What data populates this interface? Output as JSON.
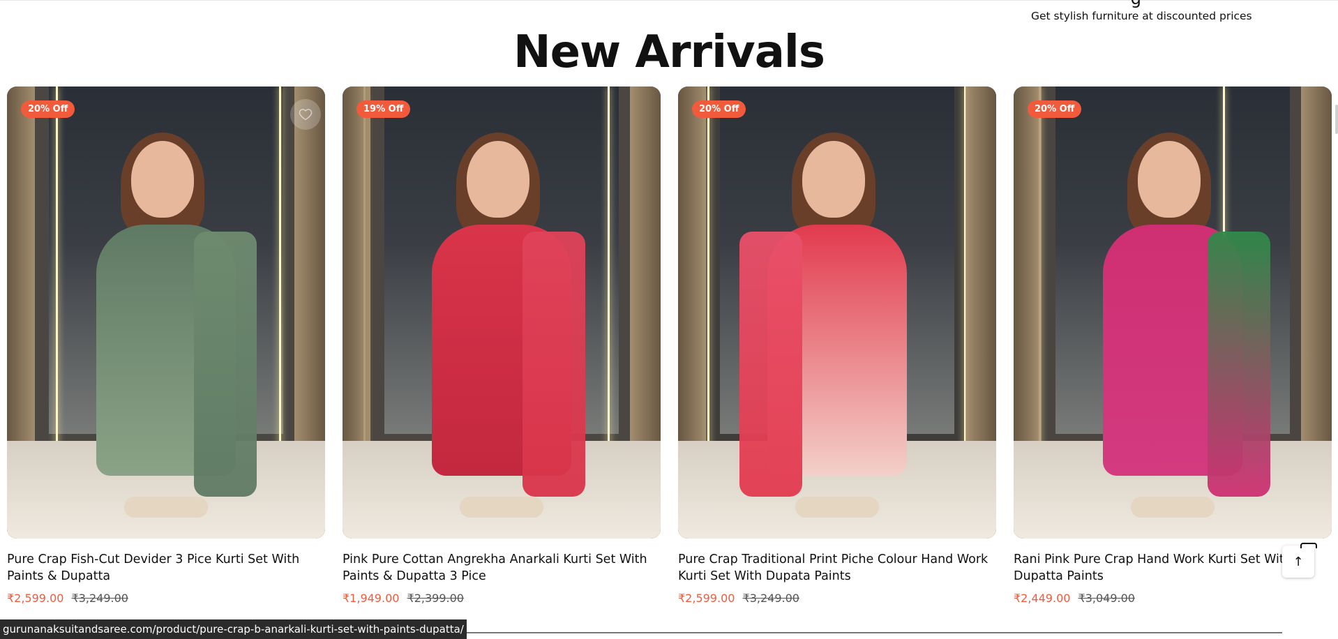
{
  "header": {
    "top_partial_glyph": "g",
    "tagline": "Get stylish furniture at discounted prices"
  },
  "section": {
    "title": "New Arrivals"
  },
  "products": [
    {
      "badge": "20% Off",
      "name": "Pure Crap Fish-Cut Devider 3 Pice Kurti Set With Paints & Dupatta",
      "price": "₹2,599.00",
      "compare_price": "₹3,249.00",
      "colors": {
        "dress": "#5f7a64",
        "dupatta": "#6e8b6f",
        "accent": "#8aa387"
      }
    },
    {
      "badge": "19% Off",
      "name": "Pink Pure Cottan Angrekha Anarkali Kurti Set With Paints & Dupatta 3 Pice",
      "price": "₹1,949.00",
      "compare_price": "₹2,399.00",
      "colors": {
        "dress": "#d9344a",
        "dupatta": "#e0435a",
        "accent": "#c2283f"
      }
    },
    {
      "badge": "20% Off",
      "name": "Pure Crap Traditional Print Piche Colour Hand Work Kurti Set With Dupata Paints",
      "price": "₹2,599.00",
      "compare_price": "₹3,249.00",
      "colors": {
        "dress": "#e23a4e",
        "dupatta": "#e9506a",
        "accent": "#f3d0c8"
      }
    },
    {
      "badge": "20% Off",
      "name": "Rani Pink Pure Crap Hand Work Kurti Set With Dupatta Paints",
      "price": "₹2,449.00",
      "compare_price": "₹3,049.00",
      "colors": {
        "dress": "#cf2f72",
        "dupatta": "#2f8a4a",
        "accent": "#d33a7f"
      }
    }
  ],
  "scroll_top": {
    "icon": "arrow-up-icon",
    "label": "↑"
  },
  "status_bar": {
    "url": "gurunanaksuitandsaree.com/product/pure-crap-b-anarkali-kurti-set-with-paints-dupatta/"
  }
}
